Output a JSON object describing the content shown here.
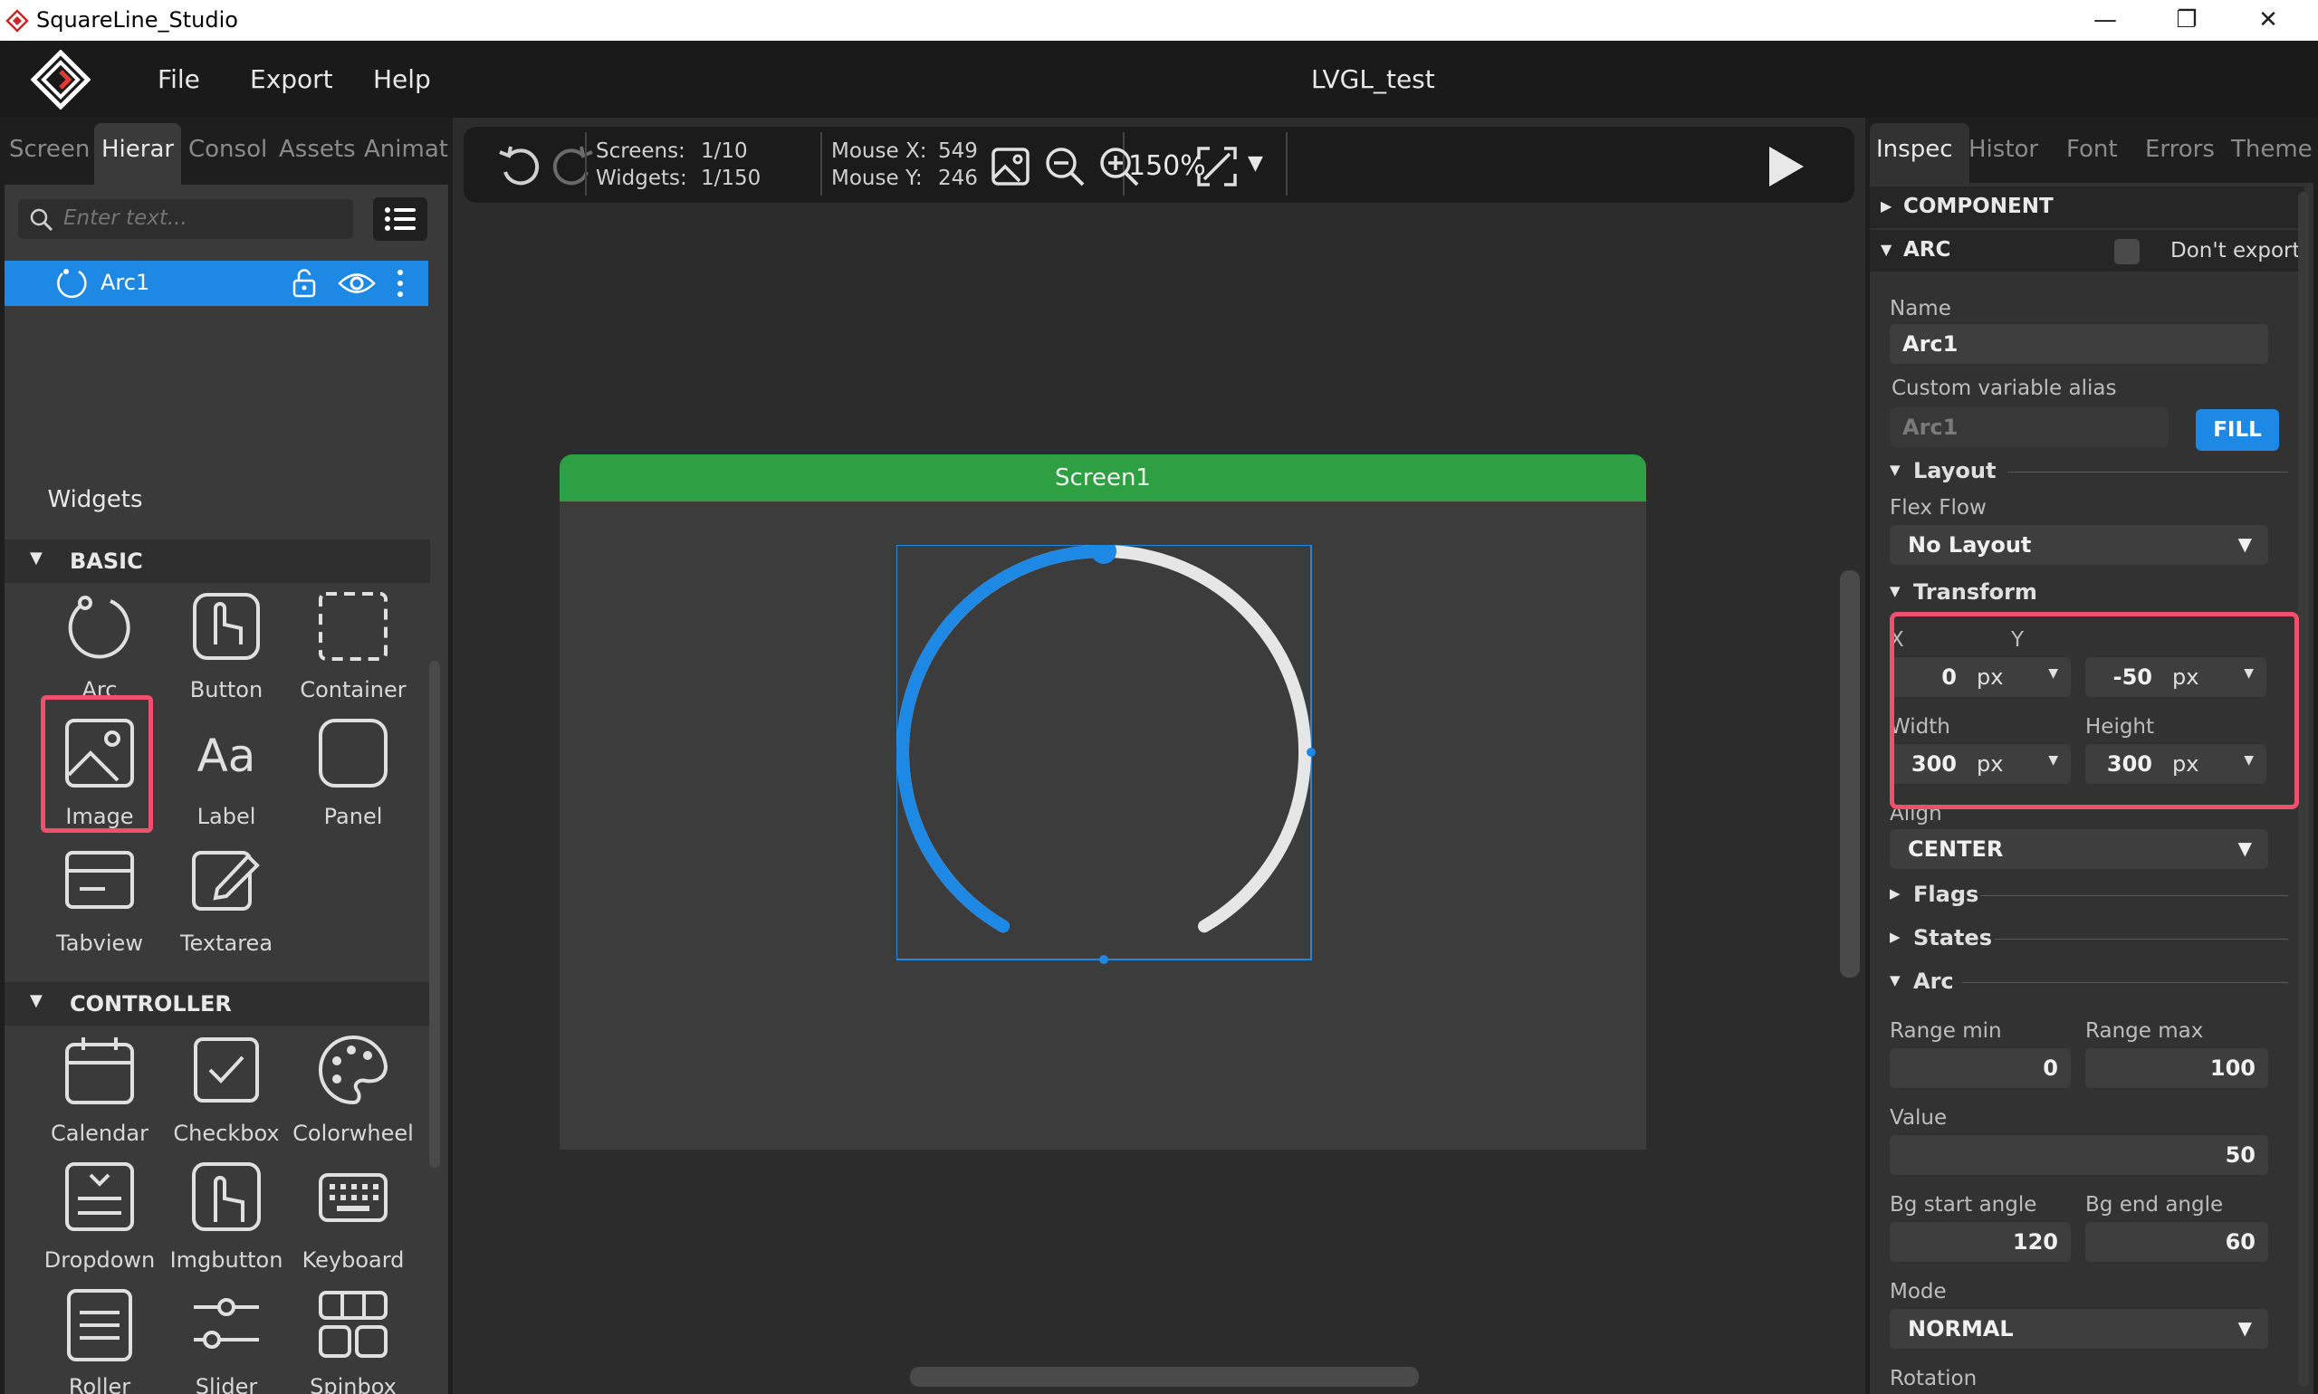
{
  "window": {
    "title": "SquareLine_Studio",
    "controls": [
      "—",
      "❐",
      "✕"
    ]
  },
  "menu": {
    "items": [
      "File",
      "Export",
      "Help"
    ],
    "project_title": "LVGL_test"
  },
  "left_tabs": [
    "Screen",
    "Hierar",
    "Consol",
    "Assets",
    "Animat"
  ],
  "hierarchy": {
    "search_placeholder": "Enter text...",
    "items": [
      {
        "label": "Arc1"
      }
    ]
  },
  "widgets_panel": {
    "tab": "Widgets",
    "sections": [
      {
        "title": "BASIC",
        "items": [
          "Arc",
          "Button",
          "Container",
          "Image",
          "Label",
          "Panel",
          "Tabview",
          "Textarea"
        ]
      },
      {
        "title": "CONTROLLER",
        "items": [
          "Calendar",
          "Checkbox",
          "Colorwheel",
          "Dropdown",
          "Imgbutton",
          "Keyboard",
          "Roller",
          "Slider",
          "Spinbox"
        ]
      }
    ]
  },
  "toolbar": {
    "screens_label": "Screens:",
    "screens_value": "1/10",
    "widgets_label": "Widgets:",
    "widgets_value": "1/150",
    "mouse_x_label": "Mouse X:",
    "mouse_x_value": "549",
    "mouse_y_label": "Mouse Y:",
    "mouse_y_value": "246",
    "zoom": "150%"
  },
  "canvas": {
    "screen_name": "Screen1",
    "arc_value_fraction": 0.5
  },
  "colors": {
    "accent": "#1e88e5",
    "screen_header": "#2ea043",
    "highlight": "#f0506e",
    "arc_bg": "#e6e6e6"
  },
  "right_tabs": [
    "Inspec",
    "Histor",
    "Font",
    "Errors",
    "Theme"
  ],
  "inspector": {
    "component_section": "COMPONENT",
    "arc_section": "ARC",
    "dont_export": "Don't export",
    "name_label": "Name",
    "name_value": "Arc1",
    "alias_label": "Custom variable alias",
    "alias_value": "Arc1",
    "fill_button": "FILL",
    "layout_section": "Layout",
    "flex_flow_label": "Flex Flow",
    "flex_flow_value": "No Layout",
    "transform_section": "Transform",
    "x_label": "X",
    "x_value": "0",
    "y_label": "Y",
    "y_value": "-50",
    "unit": "px",
    "width_label": "Width",
    "width_value": "300",
    "height_label": "Height",
    "height_value": "300",
    "align_label": "Align",
    "align_value": "CENTER",
    "flags_section": "Flags",
    "states_section": "States",
    "arc_sub_section": "Arc",
    "range_min_label": "Range min",
    "range_min_value": "0",
    "range_max_label": "Range max",
    "range_max_value": "100",
    "value_label": "Value",
    "value_value": "50",
    "bg_start_label": "Bg start angle",
    "bg_start_value": "120",
    "bg_end_label": "Bg end angle",
    "bg_end_value": "60",
    "mode_label": "Mode",
    "mode_value": "NORMAL",
    "rotation_label": "Rotation"
  }
}
